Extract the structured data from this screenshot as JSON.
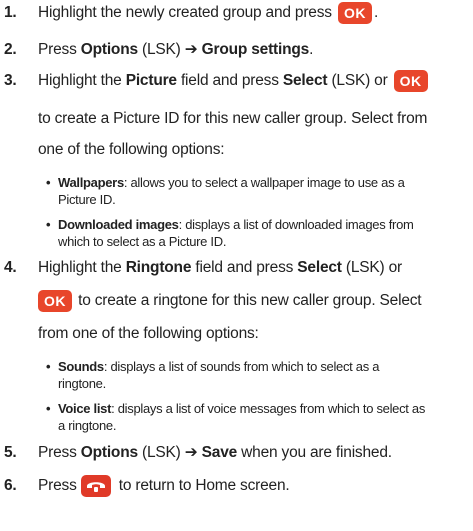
{
  "steps": [
    {
      "number": "1.",
      "pre": "Highlight the newly created group and press",
      "key": "OK",
      "post": "."
    },
    {
      "number": "2.",
      "t1": "Press ",
      "b1": "Options",
      "t2": " (LSK) ",
      "arrow": "➔",
      "b2": "Group settings",
      "t3": "."
    },
    {
      "number": "3.",
      "t1": "Highlight the ",
      "b1": "Picture",
      "t2": " field and press ",
      "b2": "Select",
      "t3": " (LSK) or",
      "key": "OK",
      "line2": "to create a Picture ID for this new caller group. Select from",
      "line3": "one of the following options:"
    },
    {
      "number": "4.",
      "t1": "Highlight the ",
      "b1": "Ringtone",
      "t2": " field and press ",
      "b2": "Select",
      "t3": " (LSK) or",
      "key": "OK",
      "line2": " to create a ringtone for this new caller group. Select",
      "line3": "from one of the following options:"
    },
    {
      "number": "5.",
      "t1": "Press ",
      "b1": "Options",
      "t2": " (LSK) ",
      "arrow": "➔",
      "b2": "Save",
      "t3": " when you are finished."
    },
    {
      "number": "6.",
      "t1": "Press",
      "t2": " to return to Home screen."
    }
  ],
  "bullets3": [
    {
      "term": "Wallpapers",
      "l1": ": allows you to select a wallpaper image to use as a",
      "l2": "Picture ID."
    },
    {
      "term": "Downloaded images",
      "l1": ": displays a list of downloaded images from",
      "l2": "which to select as a Picture ID."
    }
  ],
  "bullets4": [
    {
      "term": "Sounds",
      "l1": ": displays a list of sounds from which to select as a",
      "l2": "ringtone."
    },
    {
      "term": "Voice list",
      "l1": ": displays a list of voice messages from which to select as",
      "l2": "a ringtone."
    }
  ],
  "bullet_glyph": "•",
  "colors": {
    "ok_key": "#e8462b",
    "end_key": "#e03a28",
    "text": "#222222"
  }
}
